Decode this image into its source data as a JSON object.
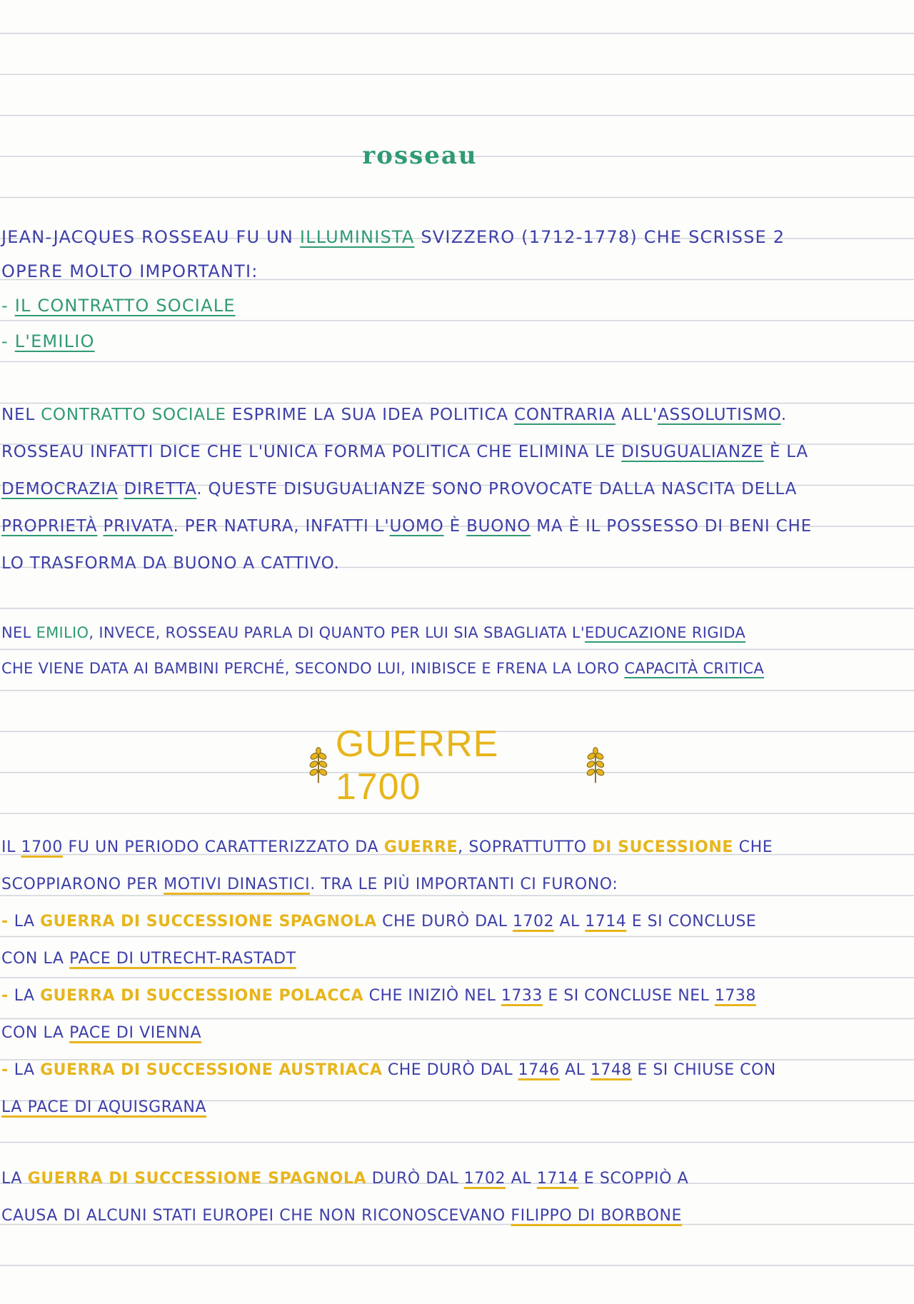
{
  "title": "rosseau",
  "intro": {
    "line1_a": "JEAN-JACQUES ROSSEAU FU UN ",
    "line1_b": "ILLUMINISTA",
    "line1_c": " SVIZZERO (1712-1778) CHE SCRISSE 2",
    "line2": "OPERE MOLTO IMPORTANTI:",
    "item1_dash": "- ",
    "item1": "IL CONTRATTO SOCIALE",
    "item2_dash": "- ",
    "item2": "L'EMILIO"
  },
  "para_contratto": {
    "l1_a": "NEL ",
    "l1_b": "CONTRATTO SOCIALE",
    "l1_c": " ESPRIME LA SUA IDEA POLITICA ",
    "l1_d": "CONTRARIA",
    "l1_e": " ALL'",
    "l1_f": "ASSOLUTISMO",
    "l1_g": ".",
    "l2_a": "ROSSEAU INFATTI DICE CHE L'UNICA FORMA POLITICA CHE ELIMINA LE ",
    "l2_b": "DISUGUALIANZE",
    "l2_c": " È LA",
    "l3_a": "DEMOCRAZIA",
    "l3_b": " ",
    "l3_c": "DIRETTA",
    "l3_d": ". QUESTE DISUGUALIANZE SONO PROVOCATE DALLA NASCITA DELLA",
    "l4_a": "PROPRIETÀ",
    "l4_b": " ",
    "l4_c": "PRIVATA",
    "l4_d": ". PER NATURA, INFATTI L'",
    "l4_e": "UOMO",
    "l4_f": " È ",
    "l4_g": "BUONO",
    "l4_h": " MA È IL POSSESSO DI BENI CHE",
    "l5": "LO TRASFORMA DA BUONO A CATTIVO."
  },
  "para_emilio": {
    "l1_a": "NEL ",
    "l1_b": "EMILIO",
    "l1_c": ", INVECE, ROSSEAU PARLA DI QUANTO PER LUI SIA SBAGLIATA L'",
    "l1_d": "EDUCAZIONE RIGIDA",
    "l2_a": "CHE VIENE DATA AI BAMBINI PERCHÉ, SECONDO LUI, INIBISCE E FRENA LA LORO ",
    "l2_b": "CAPACITÀ CRITICA"
  },
  "heading_guerre": "GUERRE 1700",
  "para_guerre": {
    "l1_a": "IL ",
    "l1_b": "1700",
    "l1_c": " FU UN PERIODO CARATTERIZZATO DA ",
    "l1_d": "GUERRE",
    "l1_e": ", SOPRATTUTTO ",
    "l1_f": "DI SUCESSIONE",
    "l1_g": " CHE",
    "l2_a": "SCOPPIARONO PER ",
    "l2_b": "MOTIVI DINASTICI",
    "l2_c": ". TRA LE PIÙ IMPORTANTI CI FURONO:",
    "w1_dash": "- ",
    "w1_a": "LA ",
    "w1_b": "GUERRA DI SUCCESSIONE SPAGNOLA",
    "w1_c": " CHE DURÒ DAL ",
    "w1_d": "1702",
    "w1_e": " AL ",
    "w1_f": "1714",
    "w1_g": " E SI CONCLUSE",
    "w1_l2_a": "CON LA ",
    "w1_l2_b": "PACE DI UTRECHT-RASTADT",
    "w2_dash": "- ",
    "w2_a": "LA ",
    "w2_b": "GUERRA DI SUCCESSIONE POLACCA",
    "w2_c": " CHE INIZIÒ NEL ",
    "w2_d": "1733",
    "w2_e": " E SI CONCLUSE NEL ",
    "w2_f": "1738",
    "w2_l2_a": "CON LA ",
    "w2_l2_b": "PACE DI VIENNA",
    "w3_dash": "- ",
    "w3_a": "LA ",
    "w3_b": "GUERRA DI SUCCESSIONE AUSTRIACA",
    "w3_c": " CHE DURÒ DAL ",
    "w3_d": "1746",
    "w3_e": " AL ",
    "w3_f": "1748",
    "w3_g": " E SI CHIUSE CON",
    "w3_l2": "LA PACE DI AQUISGRANA"
  },
  "para_spagnola": {
    "l1_a": "LA ",
    "l1_b": "GUERRA DI SUCCESSIONE SPAGNOLA",
    "l1_c": " DURÒ DAL ",
    "l1_d": "1702",
    "l1_e": " AL ",
    "l1_f": "1714",
    "l1_g": " E SCOPPIÒ A",
    "l2_a": "CAUSA DI ALCUNI STATI EUROPEI CHE NON RICONOSCEVANO ",
    "l2_b": "FILIPPO DI BORBONE"
  },
  "colors": {
    "blue_ink": "#3d3fa8",
    "green_ink": "#2f9a73",
    "yellow_highlight": "#e7b51c",
    "rule_lines": "#cfd3d8"
  }
}
